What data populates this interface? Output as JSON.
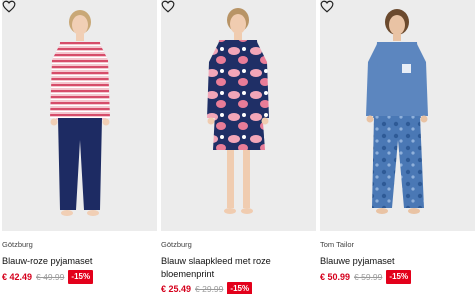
{
  "products": [
    {
      "brand": "Götzburg",
      "title": "Blauw-roze pyjamaset",
      "price_now": "€ 42.49",
      "price_old": "€ 49.99",
      "discount": "-15%",
      "favorite_icon": "heart-outline-icon"
    },
    {
      "brand": "Götzburg",
      "title": "Blauw slaapkleed met roze bloemenprint",
      "price_now": "€ 25.49",
      "price_old": "€ 29.99",
      "discount": "-15%",
      "favorite_icon": "heart-outline-icon"
    },
    {
      "brand": "Tom Tailor",
      "title": "Blauwe pyjamaset",
      "price_now": "€ 50.99",
      "price_old": "€ 59.99",
      "discount": "-15%",
      "favorite_icon": "heart-outline-icon"
    }
  ],
  "colors": {
    "sale_red": "#d5001c",
    "badge_red": "#e3001b",
    "old_price_grey": "#9a9a9a",
    "image_background": "#ececec"
  }
}
